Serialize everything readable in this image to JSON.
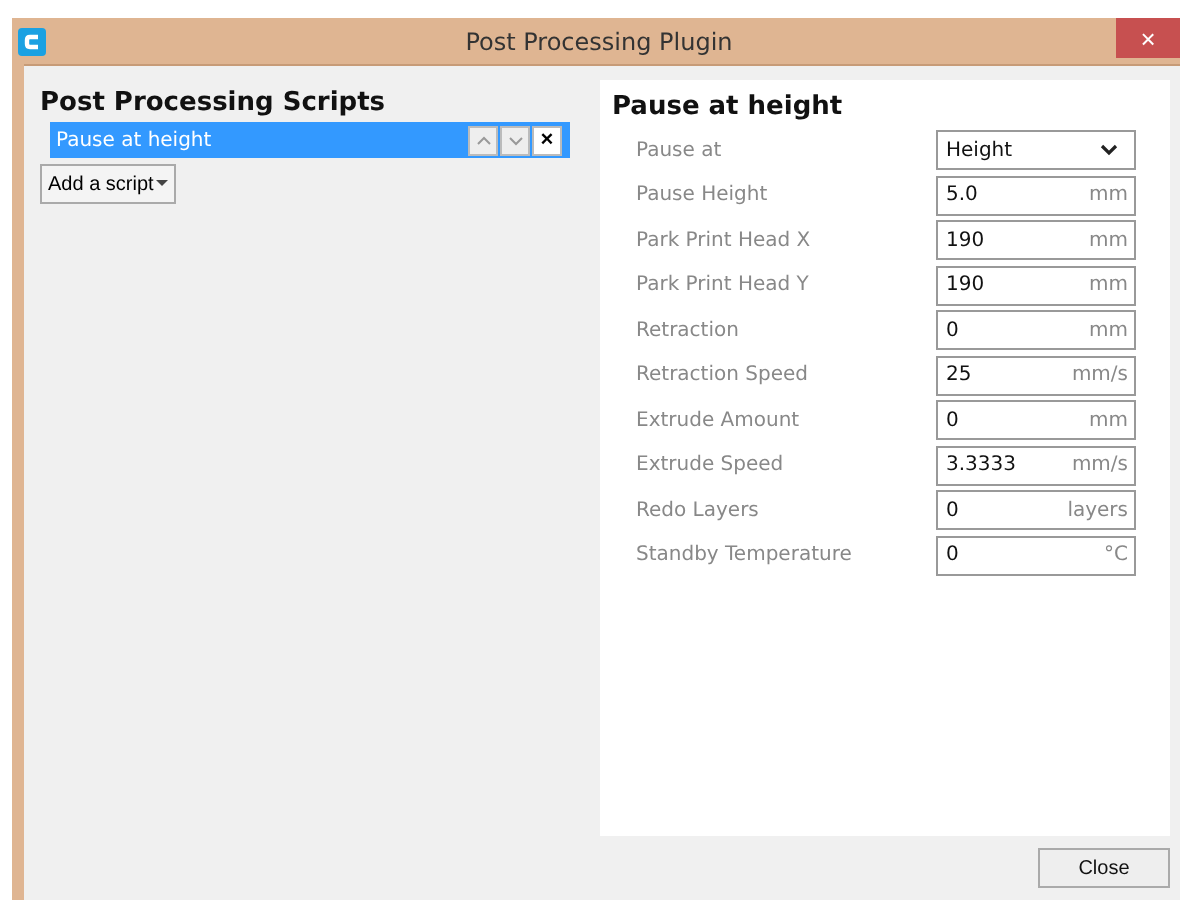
{
  "window": {
    "title": "Post Processing Plugin",
    "close": "×"
  },
  "scripts": {
    "heading": "Post Processing Scripts",
    "items": [
      {
        "label": "Pause at height",
        "selected": true,
        "remove": "×"
      }
    ],
    "add_button": "Add a script"
  },
  "settings": {
    "heading": "Pause at height",
    "fields": [
      {
        "kind": "select",
        "label": "Pause at",
        "value": "Height"
      },
      {
        "kind": "number",
        "label": "Pause Height",
        "value": "5.0",
        "unit": "mm"
      },
      {
        "kind": "number",
        "label": "Park Print Head X",
        "value": "190",
        "unit": "mm"
      },
      {
        "kind": "number",
        "label": "Park Print Head Y",
        "value": "190",
        "unit": "mm"
      },
      {
        "kind": "number",
        "label": "Retraction",
        "value": "0",
        "unit": "mm"
      },
      {
        "kind": "number",
        "label": "Retraction Speed",
        "value": "25",
        "unit": "mm/s"
      },
      {
        "kind": "number",
        "label": "Extrude Amount",
        "value": "0",
        "unit": "mm"
      },
      {
        "kind": "number",
        "label": "Extrude Speed",
        "value": "3.3333",
        "unit": "mm/s"
      },
      {
        "kind": "number",
        "label": "Redo Layers",
        "value": "0",
        "unit": "layers"
      },
      {
        "kind": "number",
        "label": "Standby Temperature",
        "value": "0",
        "unit": "°C"
      }
    ]
  },
  "footer": {
    "close_button": "Close"
  }
}
